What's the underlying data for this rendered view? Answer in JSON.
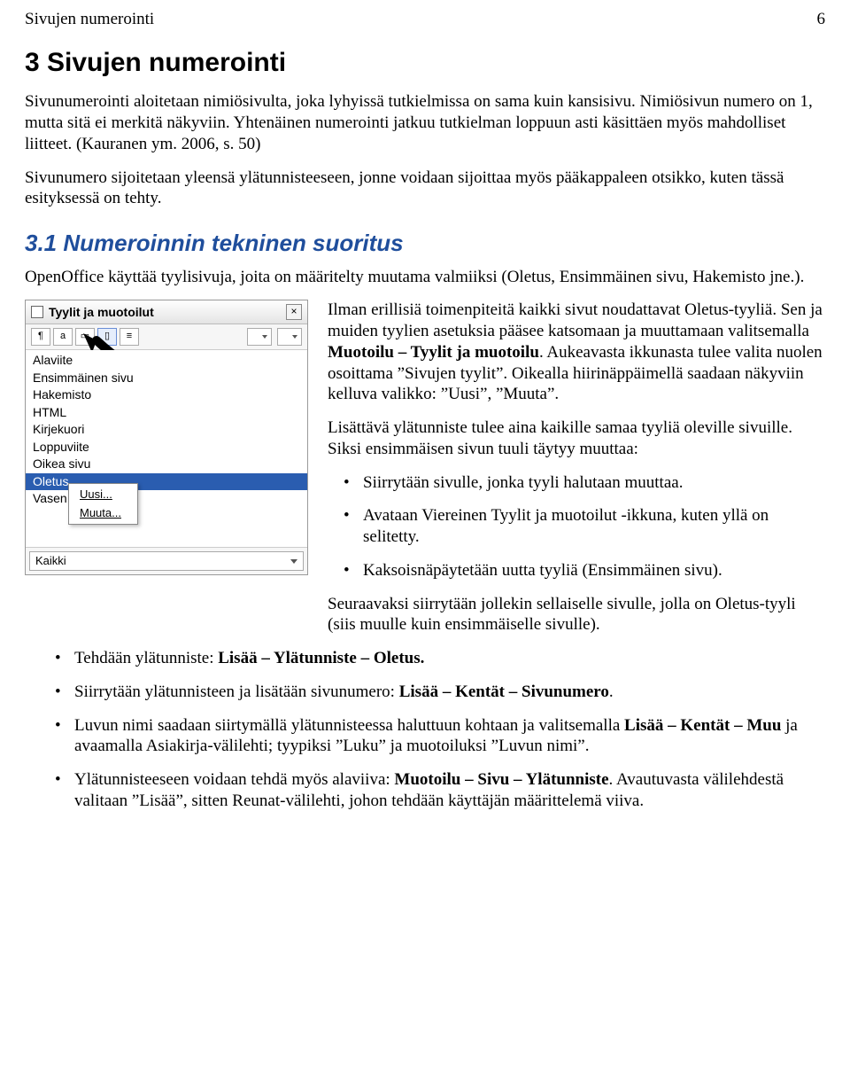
{
  "header": {
    "section": "Sivujen numerointi",
    "page": "6"
  },
  "h1": "3  Sivujen numerointi",
  "p1": "Sivunumerointi aloitetaan nimiösivulta, joka lyhyissä tutkielmissa on sama kuin kansisivu. Nimiösivun numero on 1, mutta sitä ei merkitä näkyviin. Yhtenäinen numerointi jatkuu tutkielman loppuun asti käsittäen myös mahdolliset liitteet. (Kauranen ym. 2006, s. 50)",
  "p2": "Sivunumero sijoitetaan yleensä ylätunnisteeseen, jonne voidaan sijoittaa myös pääkappaleen otsikko, kuten tässä esityksessä on tehty.",
  "h2": "3.1  Numeroinnin tekninen suoritus",
  "p3": "OpenOffice käyttää tyylisivuja, joita on määritelty muutama valmiiksi  (Oletus, Ensimmäinen sivu, Hakemisto jne.).",
  "figure": {
    "title": "Tyylit ja muotoilut",
    "toolbar_icons": [
      "paragraph-icon",
      "char-icon",
      "frame-icon",
      "page-icon",
      "list-icon"
    ],
    "items": [
      "Alaviite",
      "Ensimmäinen sivu",
      "Hakemisto",
      "HTML",
      "Kirjekuori",
      "Loppuviite",
      "Oikea sivu",
      "Oletus",
      "Vasen"
    ],
    "selected_index": 7,
    "context_menu": [
      "Uusi...",
      "Muuta..."
    ],
    "footer_select": "Kaikki"
  },
  "right": {
    "p1a": "Ilman erillisiä toimenpiteitä kaikki sivut noudattavat Oletus-tyyliä. Sen ja muiden tyylien asetuksia pääsee katsomaan ja muuttamaan valitsemalla ",
    "p1b": "Muotoilu – Tyylit ja muotoilu",
    "p1c": ". Aukeavasta ikkunasta tulee valita nuolen osoittama ”Sivujen tyylit”. Oikealla hiirinäppäimellä saadaan näkyviin kelluva valikko: ”Uusi”, ”Muuta”.",
    "p2": "Lisättävä ylätunniste tulee aina kaikille samaa tyyliä oleville sivuille. Siksi ensimmäisen sivun tuuli täytyy muuttaa:",
    "b1": "Siirrytään sivulle, jonka tyyli halutaan muuttaa.",
    "b2": "Avataan Viereinen Tyylit ja muotoilut -ikkuna, kuten yllä on selitetty.",
    "b3": "Kaksoisnäpäytetään uutta tyyliä (Ensimmäinen sivu).",
    "p3": "Seuraavaksi siirrytään jollekin sellaiselle sivulle, jolla on Oletus-tyyli (siis muulle kuin ensimmäiselle sivulle)."
  },
  "bottom": {
    "i1a": "Tehdään ylätunniste: ",
    "i1b": "Lisää – Ylätunniste – Oletus.",
    "i2a": "Siirrytään ylätunnisteen ja lisätään sivunumero: ",
    "i2b": "Lisää – Kentät – Sivunumero",
    "i2c": ".",
    "i3a": "Luvun nimi saadaan siirtymällä ylätunnisteessa haluttuun kohtaan ja valitsemalla  ",
    "i3b": "Lisää – Kentät – Muu",
    "i3c": " ja avaamalla Asiakirja-välilehti; tyypiksi ”Luku” ja muotoiluksi ”Luvun nimi”.",
    "i4a": "Ylätunnisteeseen voidaan tehdä myös alaviiva: ",
    "i4b": "Muotoilu – Sivu – Ylätunniste",
    "i4c": ". Avautuvasta välilehdestä valitaan ”Lisää”, sitten Reunat-välilehti, johon tehdään käyttäjän määrittelemä viiva."
  }
}
